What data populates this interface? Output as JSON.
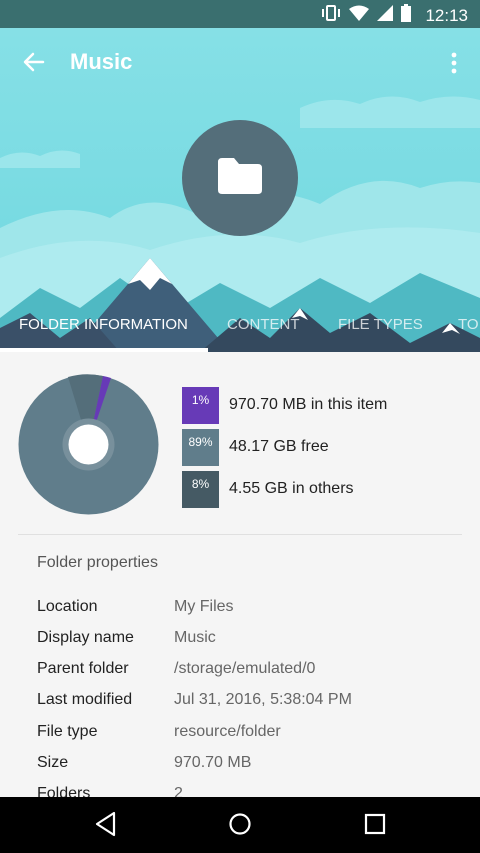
{
  "status": {
    "time": "12:13"
  },
  "appbar": {
    "title": "Music"
  },
  "tabs": [
    {
      "label": "FOLDER INFORMATION"
    },
    {
      "label": "CONTENT"
    },
    {
      "label": "FILE TYPES"
    },
    {
      "label": "TO"
    }
  ],
  "usage": {
    "items": [
      {
        "percent": "1%",
        "text": "970.70 MB in this item",
        "color": "#673ab7"
      },
      {
        "percent": "89%",
        "text": "48.17 GB free",
        "color": "#607d8b"
      },
      {
        "percent": "8%",
        "text": "4.55 GB in others",
        "color": "#455a64"
      }
    ]
  },
  "properties": {
    "heading": "Folder properties",
    "rows": [
      {
        "key": "Location",
        "value": "My Files"
      },
      {
        "key": "Display name",
        "value": "Music"
      },
      {
        "key": "Parent folder",
        "value": "/storage/emulated/0"
      },
      {
        "key": "Last modified",
        "value": "Jul 31, 2016, 5:38:04 PM"
      },
      {
        "key": "File type",
        "value": "resource/folder"
      },
      {
        "key": "Size",
        "value": "970.70 MB"
      },
      {
        "key": "Folders",
        "value": "2"
      }
    ]
  },
  "colors": {
    "accent": "#673ab7",
    "header": "#7fdde3",
    "statusbar": "#3a6f6f"
  }
}
